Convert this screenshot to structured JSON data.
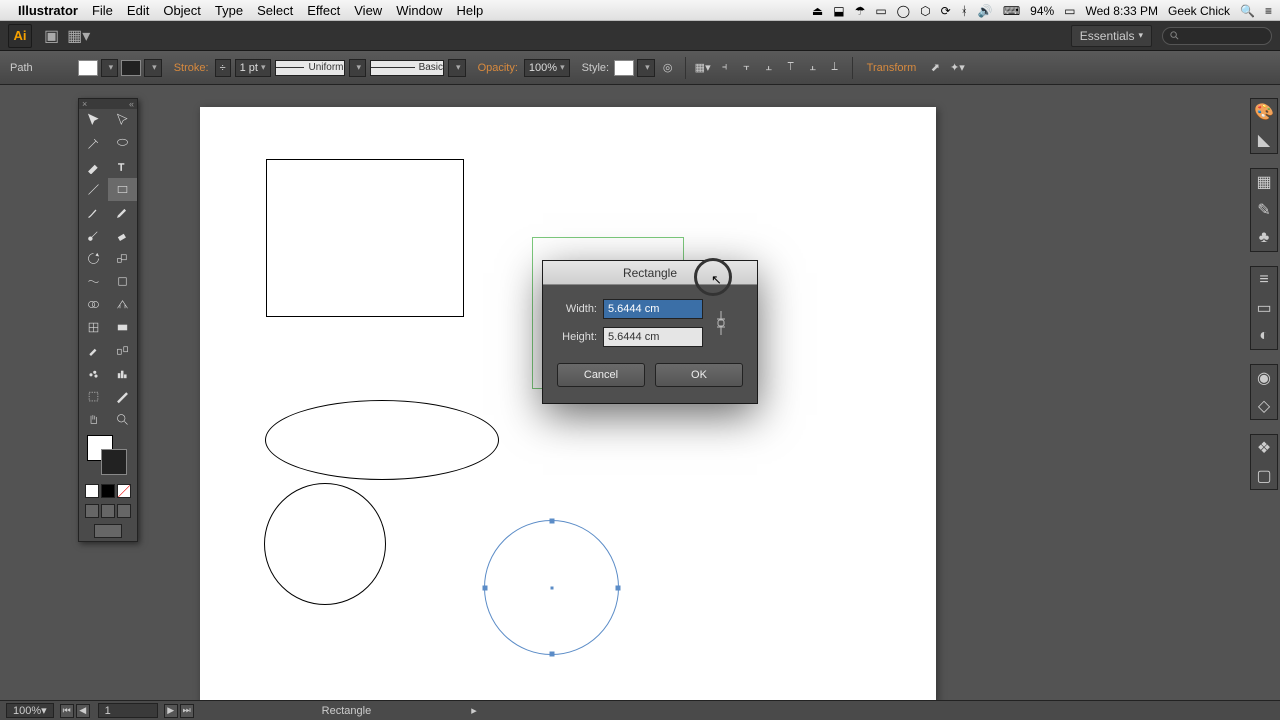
{
  "menubar": {
    "app": "Illustrator",
    "items": [
      "File",
      "Edit",
      "Object",
      "Type",
      "Select",
      "Effect",
      "View",
      "Window",
      "Help"
    ]
  },
  "mac_status": {
    "battery": "94%",
    "day_time": "Wed 8:33 PM",
    "user": "Geek Chick"
  },
  "appbar": {
    "logo": "Ai",
    "workspace": "Essentials"
  },
  "controlbar": {
    "selection_label": "Path",
    "stroke_label": "Stroke:",
    "stroke_weight": "1 pt",
    "stroke_style": "Uniform",
    "brush_style": "Basic",
    "opacity_label": "Opacity:",
    "opacity_value": "100%",
    "style_label": "Style:",
    "transform_label": "Transform"
  },
  "dialog": {
    "title": "Rectangle",
    "width_label": "Width:",
    "width_value": "5.6444 cm",
    "height_label": "Height:",
    "height_value": "5.6444 cm",
    "cancel": "Cancel",
    "ok": "OK"
  },
  "status": {
    "zoom": "100%",
    "page": "1",
    "tool": "Rectangle"
  }
}
